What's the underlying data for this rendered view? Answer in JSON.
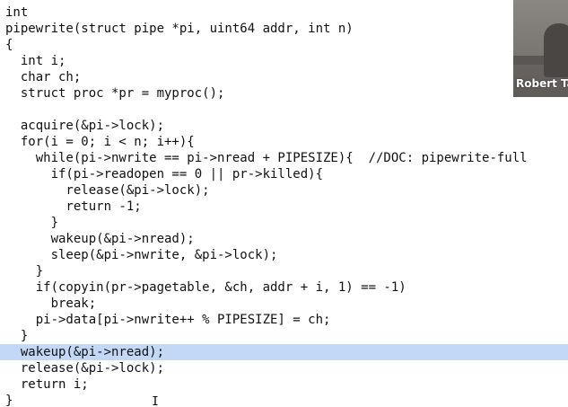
{
  "editor": {
    "highlighted_line": 21,
    "lines": [
      "int",
      "pipewrite(struct pipe *pi, uint64 addr, int n)",
      "{",
      "  int i;",
      "  char ch;",
      "  struct proc *pr = myproc();",
      "",
      "  acquire(&pi->lock);",
      "  for(i = 0; i < n; i++){",
      "    while(pi->nwrite == pi->nread + PIPESIZE){  //DOC: pipewrite-full",
      "      if(pi->readopen == 0 || pr->killed){",
      "        release(&pi->lock);",
      "        return -1;",
      "      }",
      "      wakeup(&pi->nread);",
      "      sleep(&pi->nwrite, &pi->lock);",
      "    }",
      "    if(copyin(pr->pagetable, &ch, addr + i, 1) == -1)",
      "      break;",
      "    pi->data[pi->nwrite++ % PIPESIZE] = ch;",
      "  }",
      "  wakeup(&pi->nread);",
      "  release(&pi->lock);",
      "  return i;",
      "}"
    ]
  },
  "video": {
    "participant_name": "Robert Ta"
  },
  "colors": {
    "highlight": "#c3d7f6",
    "text": "#111111",
    "background": "#ffffff"
  }
}
